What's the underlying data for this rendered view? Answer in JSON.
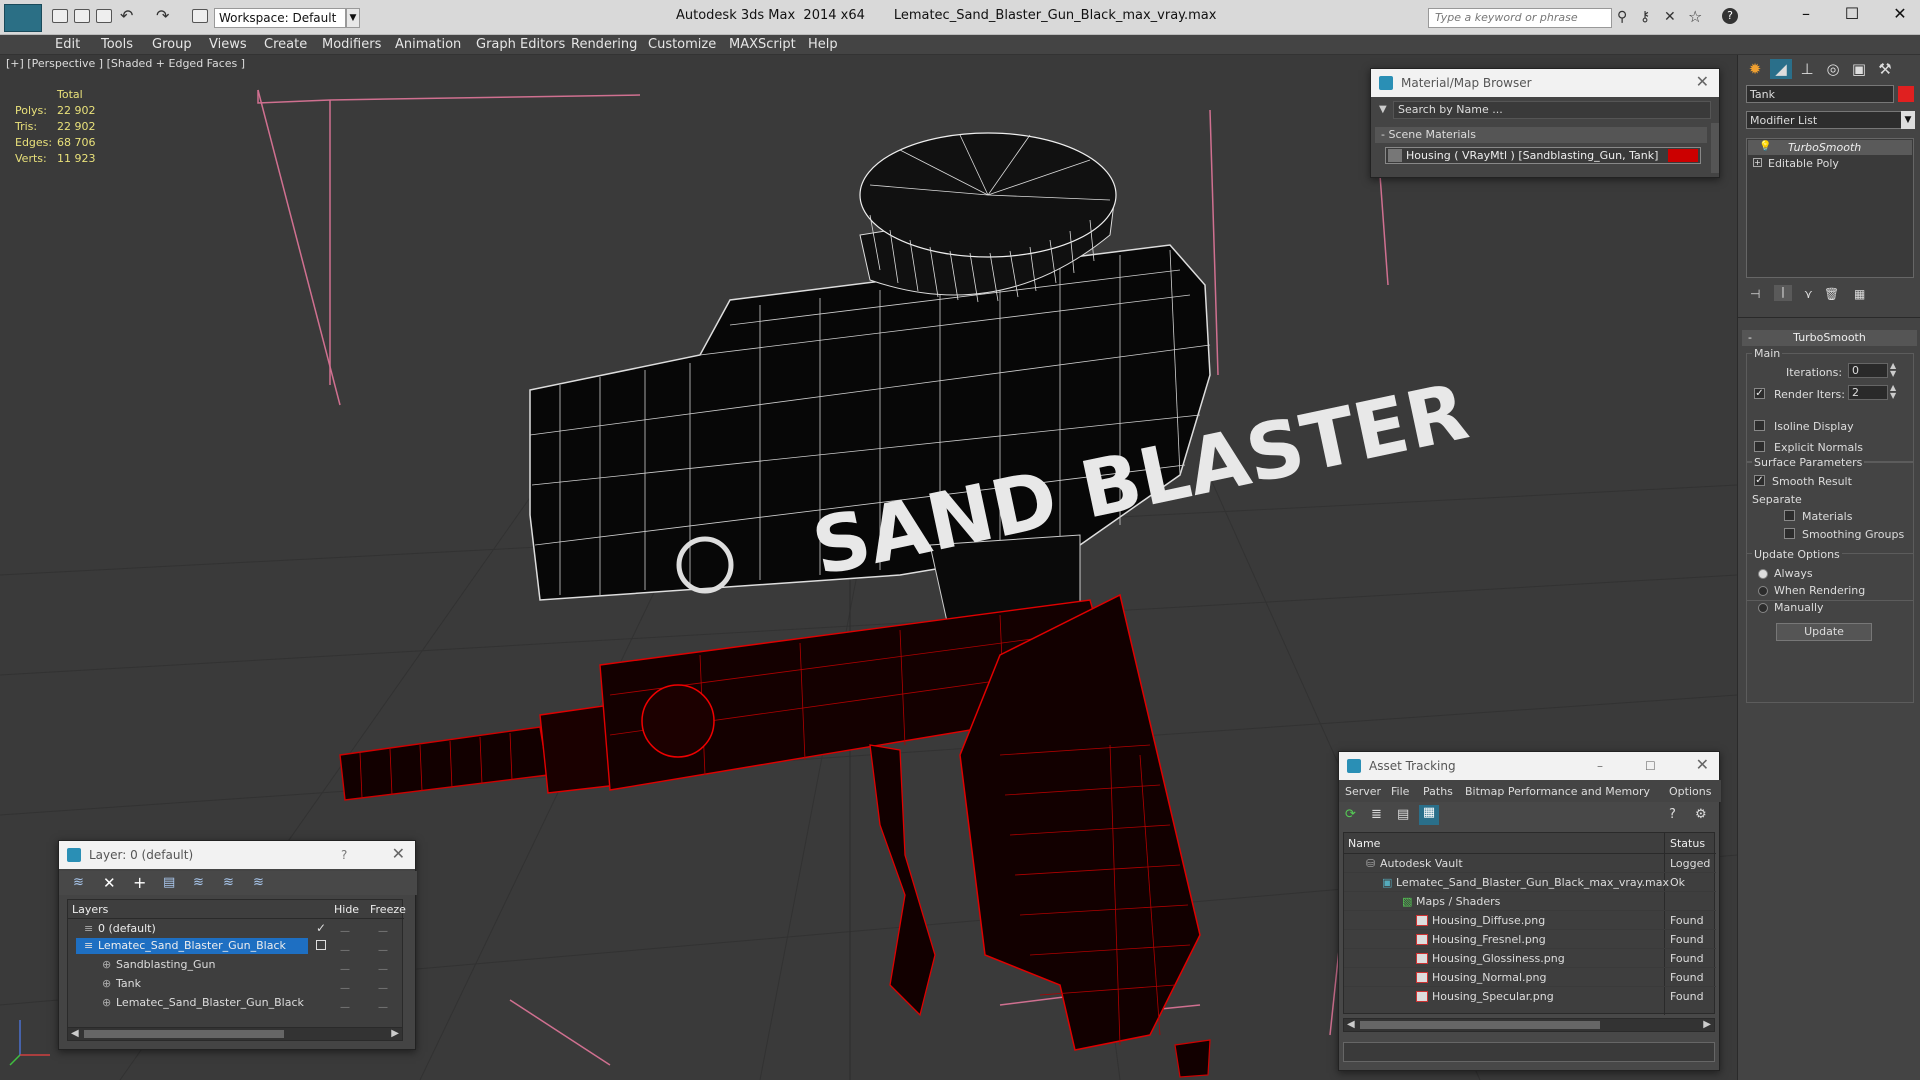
{
  "app": {
    "title": "Autodesk 3ds Max  2014 x64       Lematec_Sand_Blaster_Gun_Black_max_vray.max",
    "workspace": "Workspace: Default",
    "search_placeholder": "Type a keyword or phrase"
  },
  "menu": [
    "Edit",
    "Tools",
    "Group",
    "Views",
    "Create",
    "Modifiers",
    "Animation",
    "Graph Editors",
    "Rendering",
    "Customize",
    "MAXScript",
    "Help"
  ],
  "viewport": {
    "label": "[+] [Perspective ] [Shaded + Edged Faces ]",
    "stats": {
      "total_label": "Total",
      "polys_label": "Polys:",
      "polys": "22 902",
      "tris_label": "Tris:",
      "tris": "22 902",
      "edges_label": "Edges:",
      "edges": "68 706",
      "verts_label": "Verts:",
      "verts": "11 923"
    },
    "decal_text": "SAND BLASTER"
  },
  "material_browser": {
    "title": "Material/Map Browser",
    "search": "Search by Name ...",
    "section": "Scene Materials",
    "item": "Housing  ( VRayMtl ) [Sandblasting_Gun, Tank]",
    "item_color": "#cc0000"
  },
  "command_panel": {
    "object_name": "Tank",
    "object_color": "#e02020",
    "modifier_list": "Modifier List",
    "stack": [
      "TurboSmooth",
      "Editable Poly"
    ],
    "rollout_title": "TurboSmooth",
    "main_label": "Main",
    "iterations_label": "Iterations:",
    "iterations": "0",
    "render_iters_label": "Render Iters:",
    "render_iters": "2",
    "isoline_label": "Isoline Display",
    "explicit_normals_label": "Explicit Normals",
    "surface_params_label": "Surface Parameters",
    "smooth_result_label": "Smooth Result",
    "separate_label": "Separate",
    "materials_label": "Materials",
    "smoothing_groups_label": "Smoothing Groups",
    "update_options_label": "Update Options",
    "always_label": "Always",
    "when_rendering_label": "When Rendering",
    "manually_label": "Manually",
    "update_button": "Update"
  },
  "layer_panel": {
    "title": "Layer: 0 (default)",
    "help": "?",
    "columns": [
      "Layers",
      "Hide",
      "Freeze"
    ],
    "rows": [
      "0 (default)",
      "Lematec_Sand_Blaster_Gun_Black",
      "Sandblasting_Gun",
      "Tank",
      "Lematec_Sand_Blaster_Gun_Black"
    ]
  },
  "asset_tracking": {
    "title": "Asset Tracking",
    "menu": [
      "Server",
      "File",
      "Paths",
      "Bitmap Performance and Memory",
      "Options"
    ],
    "columns": [
      "Name",
      "Status"
    ],
    "rows": [
      {
        "name": "Autodesk Vault",
        "status": "Logged"
      },
      {
        "name": "Lematec_Sand_Blaster_Gun_Black_max_vray.max",
        "status": "Ok"
      },
      {
        "name": "Maps / Shaders",
        "status": ""
      },
      {
        "name": "Housing_Diffuse.png",
        "status": "Found"
      },
      {
        "name": "Housing_Fresnel.png",
        "status": "Found"
      },
      {
        "name": "Housing_Glossiness.png",
        "status": "Found"
      },
      {
        "name": "Housing_Normal.png",
        "status": "Found"
      },
      {
        "name": "Housing_Specular.png",
        "status": "Found"
      }
    ]
  }
}
